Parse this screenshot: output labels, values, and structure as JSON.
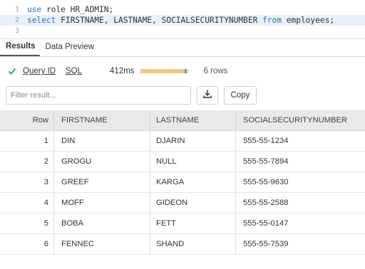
{
  "editor": {
    "lines": [
      {
        "num": "1",
        "kw1": "use",
        "text": " role HR_ADMIN;",
        "kw2": "",
        "text2": ""
      },
      {
        "num": "2",
        "kw1": "select",
        "text": " FIRSTNAME, LASTNAME, SOCIALSECURITYNUMBER ",
        "kw2": "from",
        "text2": " employees;"
      },
      {
        "num": "3",
        "kw1": "",
        "text": "",
        "kw2": "",
        "text2": ""
      }
    ]
  },
  "tabs": {
    "results": "Results",
    "preview": "Data Preview"
  },
  "status": {
    "query_id": "Query ID",
    "sql": "SQL",
    "duration": "412ms",
    "progress": 0.96,
    "rows": "6 rows",
    "success_color": "#3aa757"
  },
  "toolbar": {
    "filter_placeholder": "Filter result...",
    "download_icon": "download-icon",
    "copy_label": "Copy"
  },
  "table": {
    "columns": [
      "Row",
      "FIRSTNAME",
      "LASTNAME",
      "SOCIALSECURITYNUMBER"
    ],
    "rows": [
      [
        "1",
        "DIN",
        "DJARIN",
        "555-55-1234"
      ],
      [
        "2",
        "GROGU",
        "NULL",
        "555-55-7894"
      ],
      [
        "3",
        "GREEF",
        "KARGA",
        "555-55-9630"
      ],
      [
        "4",
        "MOFF",
        "GIDEON",
        "555-55-2588"
      ],
      [
        "5",
        "BOBA",
        "FETT",
        "555-55-0147"
      ],
      [
        "6",
        "FENNEC",
        "SHAND",
        "555-55-7539"
      ]
    ]
  }
}
